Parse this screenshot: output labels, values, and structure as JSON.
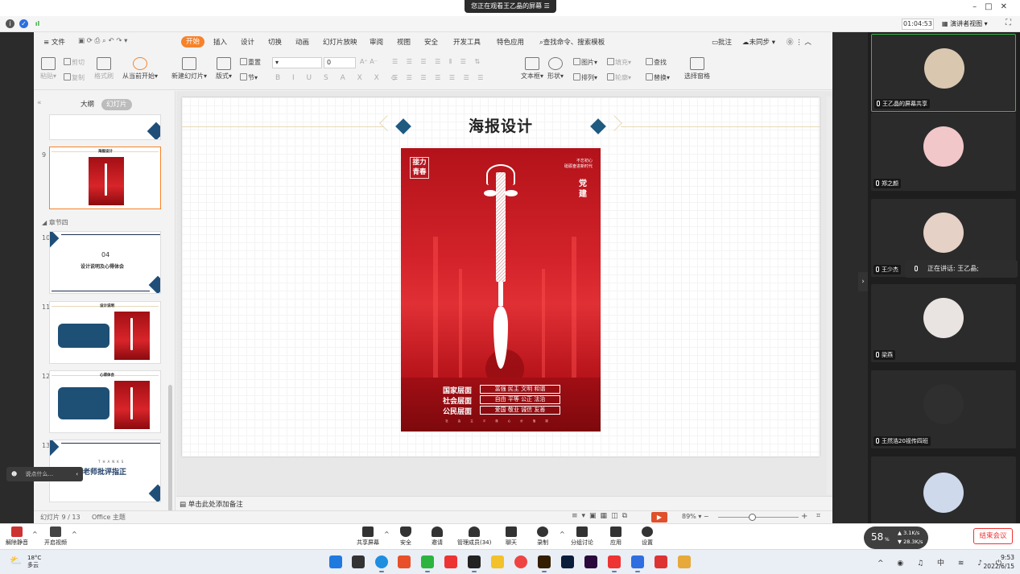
{
  "meeting": {
    "viewing_banner": "您正在观看王乙晶的屏幕",
    "timer": "01:04:53",
    "view_mode": "演讲者视图",
    "speaking_now": "正在讲话: 王乙晶;"
  },
  "wps": {
    "menu": [
      "文件",
      "开始",
      "插入",
      "设计",
      "切换",
      "动画",
      "幻灯片放映",
      "审阅",
      "视图",
      "安全",
      "开发工具",
      "特色应用"
    ],
    "search_placeholder": "查找命令、搜索模板",
    "comment": "批注",
    "sync": "未同步",
    "ribbon": {
      "paste": "粘贴",
      "cut": "剪切",
      "copy": "复制",
      "format_painter": "格式刷",
      "play_from_current": "从当前开始",
      "new_slide": "新建幻灯片",
      "layout": "版式",
      "reset": "重置",
      "section": "节",
      "font_size": "0",
      "textbox": "文本框",
      "shape": "形状",
      "picture": "图片",
      "fill": "填充",
      "arrange": "排列",
      "outline": "轮廓",
      "find": "查找",
      "replace": "替换",
      "selection_pane": "选择窗格"
    },
    "panel_tabs": {
      "outline": "大纲",
      "slides": "幻灯片"
    },
    "section_label": "章节四",
    "thumbnails": [
      {
        "num": "9",
        "title": "海报设计"
      },
      {
        "num": "10",
        "num_text": "04",
        "subtitle": "设计说明及心得体会"
      },
      {
        "num": "11",
        "title": "设计说明"
      },
      {
        "num": "12",
        "title": "心得体会"
      },
      {
        "num": "13",
        "title_small": "THANKS",
        "title": "请老师批评指正"
      }
    ],
    "slide": {
      "title": "海报设计",
      "poster": {
        "top_left": "接力青春",
        "top_right_1": "不忘初心",
        "top_right_2": "砥砺奋进新时代",
        "dangjian": "党建",
        "rows": [
          {
            "label": "国家层面",
            "values": "富强 民主 文明 和谐"
          },
          {
            "label": "社会层面",
            "values": "自由 平等 公正 法治"
          },
          {
            "label": "公民层面",
            "values": "爱国 敬业 诚信 友善"
          }
        ],
        "bottom_text": "社会主义核心价值观"
      }
    },
    "notes_placeholder": "单击此处添加备注",
    "status": {
      "slide_counter": "幻灯片 9 / 13",
      "theme": "Office 主题",
      "zoom": "89%"
    }
  },
  "chat_input_placeholder": "说点什么...",
  "participants": [
    {
      "name": "王乙晶的屏幕共享",
      "active": true,
      "avatar_color": "#d9c7b0"
    },
    {
      "name": "郑之颜",
      "active": false,
      "avatar_color": "#f2c7c9"
    },
    {
      "name": "王少杰",
      "active": false,
      "avatar_color": "#e6d1c6"
    },
    {
      "name": "梁燕",
      "active": false,
      "avatar_color": "#e9e4e2"
    },
    {
      "name": "王然浩20视传四班",
      "active": false,
      "avatar_color": "#2f2f2f"
    },
    {
      "name": "",
      "active": false,
      "avatar_color": "#cfd9ec"
    }
  ],
  "toolbar": {
    "unmute": "解除静音",
    "start_video": "开启视频",
    "share_screen": "共享屏幕",
    "security": "安全",
    "invite": "邀请",
    "manage_members": "管理成员(34)",
    "chat": "聊天",
    "record": "录制",
    "breakout": "分组讨论",
    "apps": "应用",
    "settings": "设置",
    "end_meeting": "结束会议",
    "network_percent": "58",
    "up_speed": "3.1",
    "down_speed": "28.3",
    "speed_unit": "K/s"
  },
  "taskbar": {
    "weather_temp": "18°C",
    "weather_desc": "多云",
    "time": "9:53",
    "date": "2022/6/15",
    "ime": "中"
  }
}
